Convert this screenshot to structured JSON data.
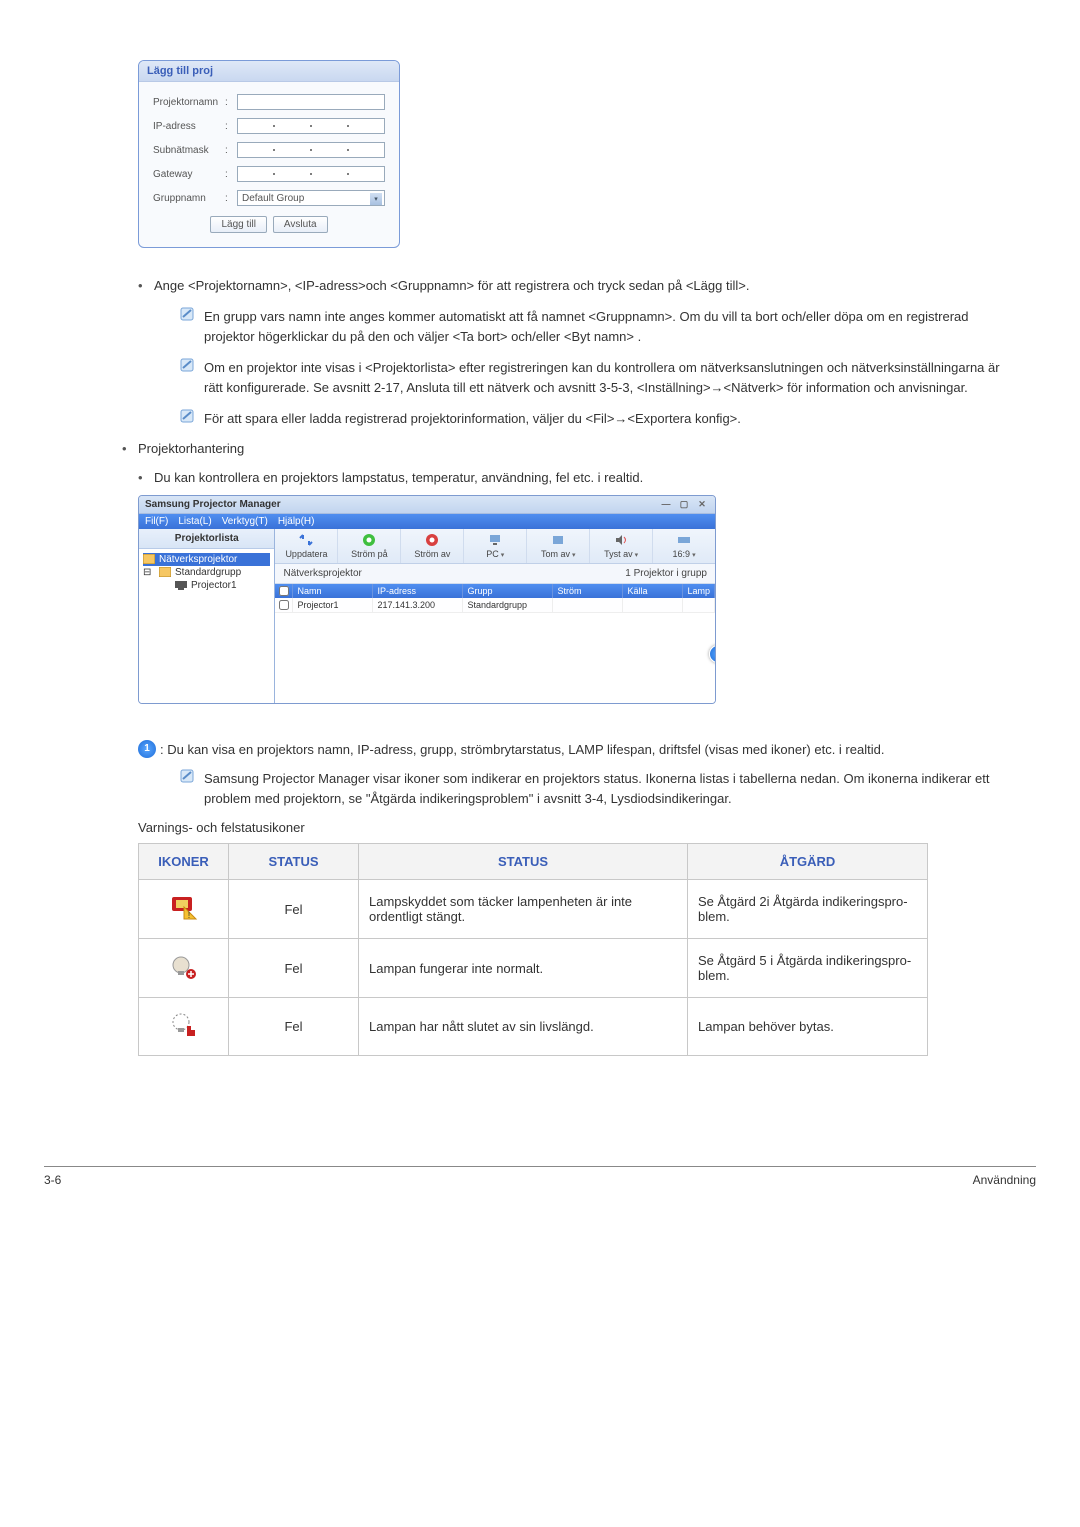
{
  "dialog1": {
    "title": "Lägg till proj",
    "labels": {
      "projektornamn": "Projektornamn",
      "ip": "IP-adress",
      "subnet": "Subnätmask",
      "gateway": "Gateway",
      "gruppnamn": "Gruppnamn"
    },
    "group_value": "Default Group",
    "btn_add": "Lägg till",
    "btn_cancel": "Avsluta"
  },
  "bullets": {
    "b1": "Ange <Projektornamn>, <IP-adress>och <Gruppnamn> för att registrera och tryck sedan på <Lägg till>.",
    "note1": "En grupp vars namn inte anges kommer automatiskt att få namnet <Gruppnamn>. Om du vill ta bort och/eller döpa om en registrerad projektor högerklickar du på den och väljer <Ta bort> och/eller <Byt namn> .",
    "note2": "Om en projektor inte visas i <Projektorlista> efter registreringen kan du kontrollera om nätverksanslutningen och nätverksinställningarna är rätt konfigurerade. Se avsnitt 2-17, Ansluta till ett nätverk och avsnitt 3-5-3, <Inställning>→<Nätverk> för information och anvisningar.",
    "note3": "För att spara eller ladda registrerad projektorinformation, väljer du <Fil>→<Exportera konfig>.",
    "b2": "Projektorhantering",
    "b2_sub": "Du kan kontrollera en projektors lampstatus, temperatur, användning, fel etc. i realtid.",
    "callout_text": ": Du kan visa en projektors namn, IP-adress, grupp, strömbrytarstatus, LAMP lifespan, driftsfel (visas med ikoner) etc. i realtid.",
    "note4": "Samsung Projector Manager visar ikoner som indikerar en projektors status. Ikonerna listas i tabellerna nedan. Om ikonerna indikerar ett problem med projektorn, se \"Åtgärda indikeringsproblem\" i avsnitt 3-4, Lysdiodsindikeringar.",
    "warn_heading": "Varnings- och felstatusikoner"
  },
  "mgr": {
    "title": "Samsung Projector Manager",
    "menu": [
      "Fil(F)",
      "Lista(L)",
      "Verktyg(T)",
      "Hjälp(H)"
    ],
    "left_title": "Projektorlista",
    "tree": {
      "root": "Nätverksprojektor",
      "group": "Standardgrupp",
      "item": "Projector1"
    },
    "toolbar": {
      "refresh": "Uppdatera",
      "power_on": "Ström på",
      "power_off": "Ström av",
      "source": "PC",
      "blank": "Tom av",
      "mute": "Tyst av",
      "aspect": "16:9"
    },
    "crumb_left": "Nätverksprojektor",
    "crumb_right": "1 Projektor i grupp",
    "grid": {
      "headers": {
        "name": "Namn",
        "ip": "IP-adress",
        "group": "Grupp",
        "power": "Ström",
        "source": "Källa",
        "lamp": "Lamp"
      },
      "row": {
        "name": "Projector1",
        "ip": "217.141.3.200",
        "group": "Standardgrupp"
      }
    },
    "callout": "1"
  },
  "table": {
    "headers": {
      "icons": "IKONER",
      "status1": "STATUS",
      "status2": "STATUS",
      "action": "ÅTGÄRD"
    },
    "rows": [
      {
        "status1": "Fel",
        "status2": "Lampskyddet som täcker lampenheten är inte ordentligt stängt.",
        "action": "Se Åtgärd 2i Åtgärda indikeringspro-blem."
      },
      {
        "status1": "Fel",
        "status2": "Lampan fungerar inte normalt.",
        "action": "Se Åtgärd 5 i Åtgärda indikeringspro-blem."
      },
      {
        "status1": "Fel",
        "status2": "Lampan har nått slutet av sin livslängd.",
        "action": "Lampan behöver bytas."
      }
    ]
  },
  "footer": {
    "left": "3-6",
    "right": "Användning"
  }
}
